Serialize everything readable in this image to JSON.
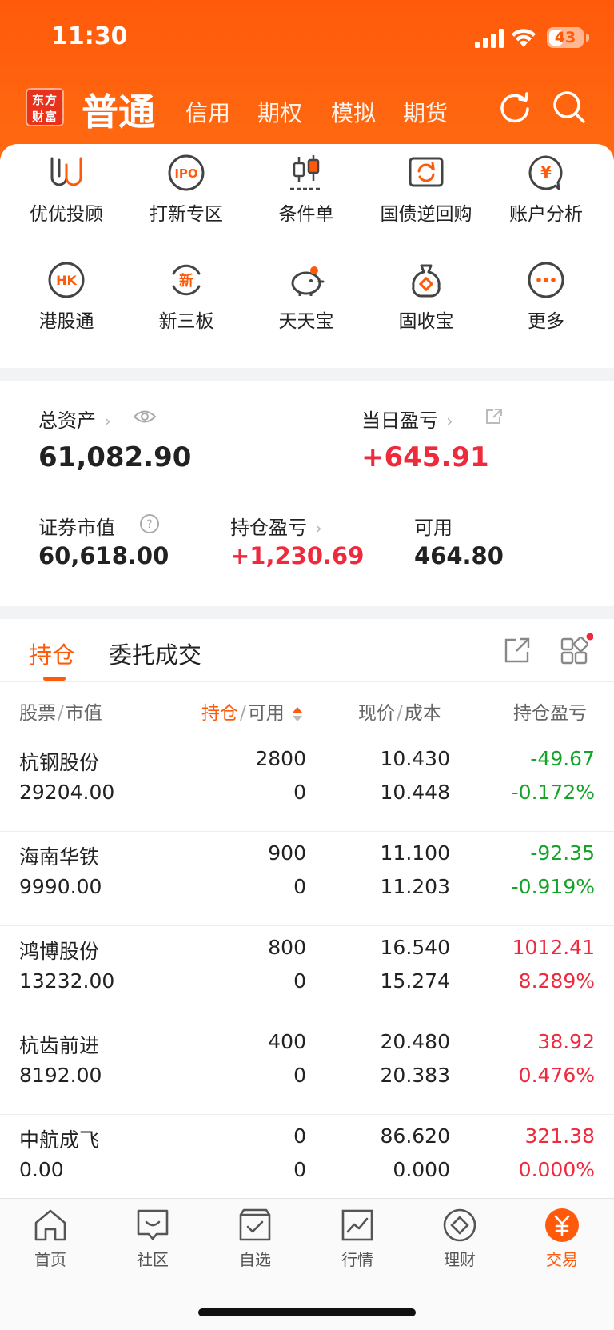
{
  "status": {
    "time": "11:30",
    "battery": "43",
    "battery_level": 0.43
  },
  "header": {
    "logo_text": "东方财富",
    "tabs": [
      "普通",
      "信用",
      "期权",
      "模拟",
      "期货"
    ],
    "active_tab": "普通",
    "icons": [
      "refresh-icon",
      "search-icon"
    ]
  },
  "quick_menu": [
    {
      "label": "优优投顾",
      "icon": "uu-advisor-icon"
    },
    {
      "label": "打新专区",
      "icon": "ipo-icon"
    },
    {
      "label": "条件单",
      "icon": "candlestick-icon"
    },
    {
      "label": "国债逆回购",
      "icon": "repo-icon"
    },
    {
      "label": "账户分析",
      "icon": "yen-chat-icon"
    },
    {
      "label": "港股通",
      "icon": "hk-icon"
    },
    {
      "label": "新三板",
      "icon": "new-board-icon"
    },
    {
      "label": "天天宝",
      "icon": "piggy-bank-icon"
    },
    {
      "label": "固收宝",
      "icon": "money-bag-icon"
    },
    {
      "label": "更多",
      "icon": "more-icon"
    }
  ],
  "assets": {
    "total_label": "总资产",
    "total_value": "61,082.90",
    "daily_pnl_label": "当日盈亏",
    "daily_pnl_value": "+645.91",
    "market_value_label": "证券市值",
    "market_value": "60,618.00",
    "holding_pnl_label": "持仓盈亏",
    "holding_pnl_value": "+1,230.69",
    "available_label": "可用",
    "available_value": "464.80"
  },
  "positions": {
    "tabs": [
      "持仓",
      "委托成交"
    ],
    "headers": {
      "stock": "股票",
      "market_value": "市值",
      "holding": "持仓",
      "available": "可用",
      "price": "现价",
      "cost": "成本",
      "pnl": "持仓盈亏",
      "sep": "/"
    },
    "rows": [
      {
        "name": "杭钢股份",
        "market_value": "29204.00",
        "holding": "2800",
        "available": "0",
        "price": "10.430",
        "cost": "10.448",
        "pnl": "-49.67",
        "pnl_pct": "-0.172%",
        "trend": "down"
      },
      {
        "name": "海南华铁",
        "market_value": "9990.00",
        "holding": "900",
        "available": "0",
        "price": "11.100",
        "cost": "11.203",
        "pnl": "-92.35",
        "pnl_pct": "-0.919%",
        "trend": "down"
      },
      {
        "name": "鸿博股份",
        "market_value": "13232.00",
        "holding": "800",
        "available": "0",
        "price": "16.540",
        "cost": "15.274",
        "pnl": "1012.41",
        "pnl_pct": "8.289%",
        "trend": "up"
      },
      {
        "name": "杭齿前进",
        "market_value": "8192.00",
        "holding": "400",
        "available": "0",
        "price": "20.480",
        "cost": "20.383",
        "pnl": "38.92",
        "pnl_pct": "0.476%",
        "trend": "up"
      },
      {
        "name": "中航成飞",
        "market_value": "0.00",
        "holding": "0",
        "available": "0",
        "price": "86.620",
        "cost": "0.000",
        "pnl": "321.38",
        "pnl_pct": "0.000%",
        "trend": "up"
      }
    ]
  },
  "bottom_nav": [
    {
      "label": "首页",
      "icon": "home-icon"
    },
    {
      "label": "社区",
      "icon": "community-icon"
    },
    {
      "label": "自选",
      "icon": "watchlist-icon"
    },
    {
      "label": "行情",
      "icon": "market-icon"
    },
    {
      "label": "理财",
      "icon": "wealth-icon"
    },
    {
      "label": "交易",
      "icon": "trade-icon",
      "active": true
    }
  ],
  "colors": {
    "brand": "#ff5a0a",
    "up": "#ee2a3c",
    "down": "#16a329"
  }
}
